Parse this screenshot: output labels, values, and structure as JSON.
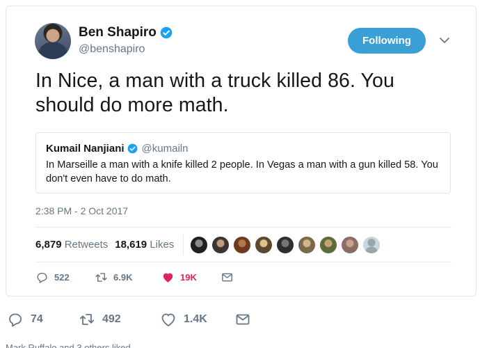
{
  "tweet": {
    "author": {
      "display_name": "Ben Shapiro",
      "handle": "@benshapiro",
      "verified": true
    },
    "follow_button_label": "Following",
    "text": "In Nice, a man with a truck killed 86. You should do more math.",
    "quoted": {
      "display_name": "Kumail Nanjiani",
      "handle": "@kumailn",
      "text": "In Marseille a man with a knife killed 2 people. In Vegas a man with a gun killed 58. You don't even have to do math."
    },
    "timestamp": "2:38 PM - 2 Oct 2017",
    "stats": {
      "retweets_count": "6,879",
      "retweets_label": "Retweets",
      "likes_count": "18,619",
      "likes_label": "Likes"
    },
    "likers_avatar_count": 9,
    "actions": {
      "replies": "522",
      "retweets": "6.9K",
      "likes": "19K"
    }
  },
  "outer_actions": {
    "replies": "74",
    "retweets": "492",
    "likes": "1.4K"
  },
  "footer_partial_text": "Mark Ruffalo and 3 others liked",
  "colors": {
    "accent": "#3a9fd4",
    "like": "#e0245e",
    "muted": "#657786"
  },
  "icons": [
    "verified-badge-icon",
    "chevron-down-icon",
    "reply-icon",
    "retweet-icon",
    "heart-icon",
    "message-icon"
  ]
}
